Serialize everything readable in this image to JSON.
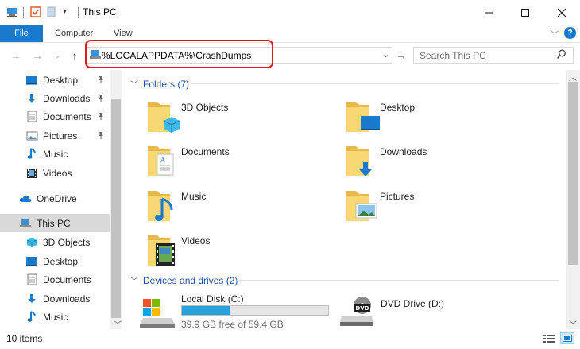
{
  "window": {
    "title": "This PC"
  },
  "ribbon": {
    "tabs": [
      "File",
      "Computer",
      "View"
    ]
  },
  "address": {
    "path": "%LOCALAPPDATA%\\CrashDumps"
  },
  "search": {
    "placeholder": "Search This PC"
  },
  "sidebar": {
    "quick_access": [
      {
        "label": "Desktop",
        "icon": "desktop-icon",
        "pinned": true
      },
      {
        "label": "Downloads",
        "icon": "downloads-icon",
        "pinned": true
      },
      {
        "label": "Documents",
        "icon": "documents-icon",
        "pinned": true
      },
      {
        "label": "Pictures",
        "icon": "pictures-icon",
        "pinned": true
      },
      {
        "label": "Music",
        "icon": "music-icon",
        "pinned": false
      },
      {
        "label": "Videos",
        "icon": "videos-icon",
        "pinned": false
      }
    ],
    "onedrive": "OneDrive",
    "this_pc": "This PC",
    "this_pc_items": [
      {
        "label": "3D Objects",
        "icon": "3d-objects-icon"
      },
      {
        "label": "Desktop",
        "icon": "desktop-icon"
      },
      {
        "label": "Documents",
        "icon": "documents-icon"
      },
      {
        "label": "Downloads",
        "icon": "downloads-icon"
      },
      {
        "label": "Music",
        "icon": "music-icon"
      }
    ]
  },
  "content": {
    "folders_header": "Folders (7)",
    "folders": [
      {
        "label": "3D Objects",
        "icon": "3d-objects-folder-icon"
      },
      {
        "label": "Desktop",
        "icon": "desktop-folder-icon"
      },
      {
        "label": "Documents",
        "icon": "documents-folder-icon"
      },
      {
        "label": "Downloads",
        "icon": "downloads-folder-icon"
      },
      {
        "label": "Music",
        "icon": "music-folder-icon"
      },
      {
        "label": "Pictures",
        "icon": "pictures-folder-icon"
      },
      {
        "label": "Videos",
        "icon": "videos-folder-icon"
      }
    ],
    "drives_header": "Devices and drives (2)",
    "drives": [
      {
        "label": "Local Disk (C:)",
        "free": "39.9 GB free of 59.4 GB",
        "used_fraction": 0.328
      },
      {
        "label": "DVD Drive (D:)"
      }
    ]
  },
  "status": {
    "items": "10 items"
  },
  "colors": {
    "accent": "#1979ca",
    "folder": "#f8d775",
    "highlight": "#e0191b",
    "drive_fill": "#26a0da"
  }
}
